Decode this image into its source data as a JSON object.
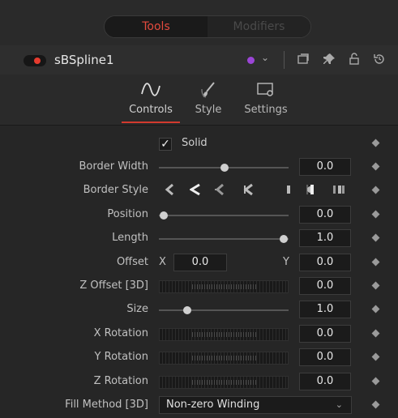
{
  "tabs": {
    "tools": "Tools",
    "modifiers": "Modifiers"
  },
  "header": {
    "node_name": "sBSpline1",
    "color_chevron": "⌄"
  },
  "subtabs": {
    "controls": "Controls",
    "style": "Style",
    "settings": "Settings"
  },
  "controls": {
    "solid_label": "Solid",
    "solid_checked": true,
    "border_width": {
      "label": "Border Width",
      "value": "0.0",
      "slider_fraction": 0.5
    },
    "border_style": {
      "label": "Border Style"
    },
    "position": {
      "label": "Position",
      "value": "0.0",
      "slider_fraction": 0.0
    },
    "length": {
      "label": "Length",
      "value": "1.0",
      "slider_fraction": 1.0
    },
    "offset": {
      "label": "Offset",
      "x_label": "X",
      "x_value": "0.0",
      "y_label": "Y",
      "y_value": "0.0"
    },
    "z_offset": {
      "label": "Z Offset [3D]",
      "value": "0.0"
    },
    "size": {
      "label": "Size",
      "value": "1.0",
      "slider_fraction": 0.2
    },
    "x_rotation": {
      "label": "X Rotation",
      "value": "0.0"
    },
    "y_rotation": {
      "label": "Y Rotation",
      "value": "0.0"
    },
    "z_rotation": {
      "label": "Z Rotation",
      "value": "0.0"
    },
    "fill_method": {
      "label": "Fill Method [3D]",
      "value": "Non-zero Winding"
    }
  },
  "colors": {
    "accent": "#e44a3e",
    "node_color": "#9b45d6",
    "power": "#e63b2e"
  }
}
